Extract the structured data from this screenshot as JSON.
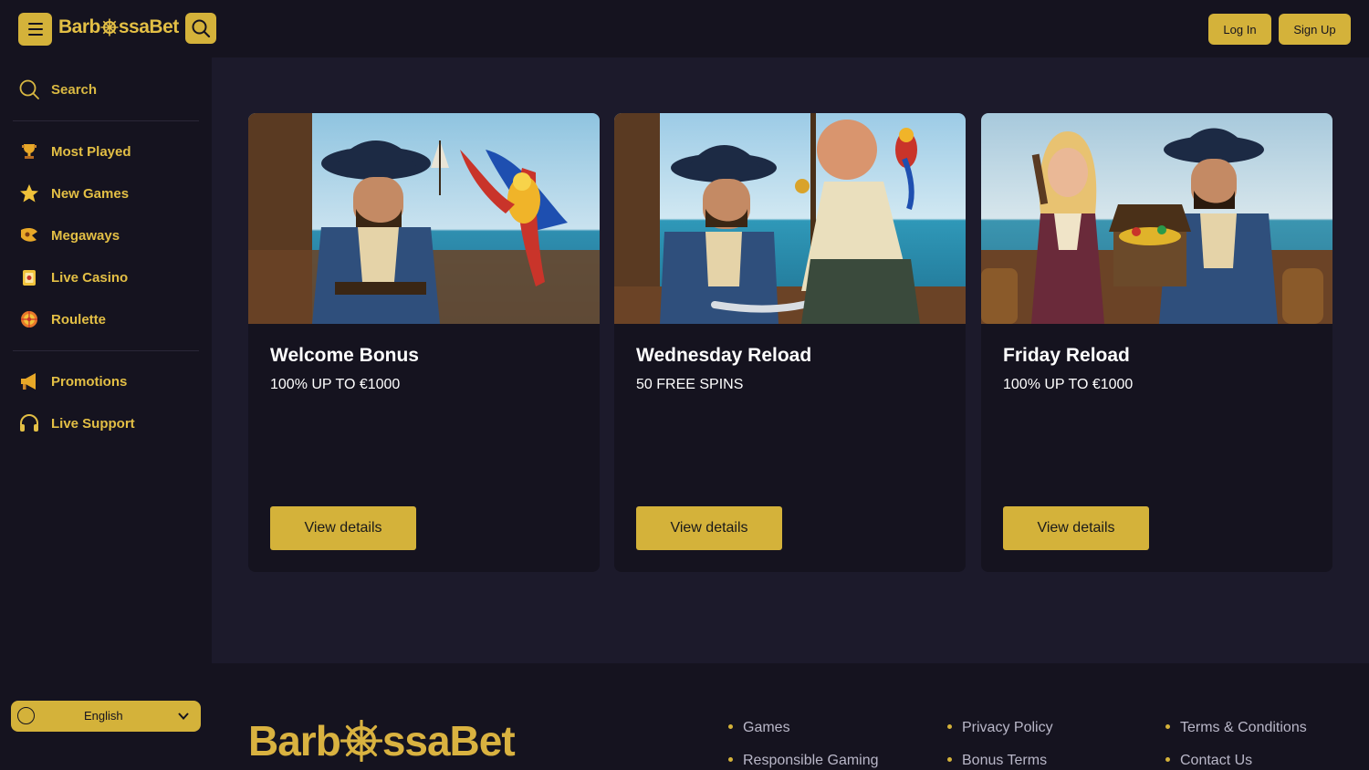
{
  "brand": {
    "name_part1": "Barb",
    "name_part2": "ssaBet",
    "accent": "#d4b23a",
    "bg": "#15131f",
    "main_bg": "#1c1a2b"
  },
  "header": {
    "login_label": "Log In",
    "signup_label": "Sign Up"
  },
  "sidebar": {
    "search_label": "Search",
    "items": [
      {
        "label": "Most Played",
        "icon": "trophy-icon"
      },
      {
        "label": "New Games",
        "icon": "star-icon"
      },
      {
        "label": "Megaways",
        "icon": "megaways-icon"
      },
      {
        "label": "Live Casino",
        "icon": "live-casino-icon"
      },
      {
        "label": "Roulette",
        "icon": "roulette-icon"
      }
    ],
    "items2": [
      {
        "label": "Promotions",
        "icon": "megaphone-icon"
      },
      {
        "label": "Live Support",
        "icon": "headset-icon"
      }
    ],
    "language": "English"
  },
  "promotions": [
    {
      "title": "Welcome Bonus",
      "subtitle": "100% UP TO €1000",
      "button": "View details",
      "image": "pirate-with-parrot"
    },
    {
      "title": "Wednesday Reload",
      "subtitle": "50 FREE SPINS",
      "button": "View details",
      "image": "pirates-with-coin"
    },
    {
      "title": "Friday Reload",
      "subtitle": "100% UP TO €1000",
      "button": "View details",
      "image": "pirates-with-treasure"
    }
  ],
  "footer": {
    "links": [
      "Games",
      "Responsible Gaming",
      "Privacy Policy",
      "Bonus Terms",
      "Terms & Conditions",
      "Contact Us"
    ]
  }
}
